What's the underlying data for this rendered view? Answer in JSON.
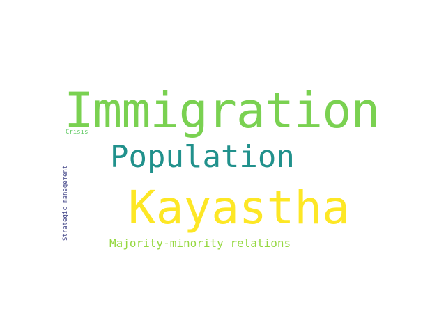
{
  "words": [
    {
      "text": "Immigration",
      "color": "#7ad151"
    },
    {
      "text": "Population",
      "color": "#21918c"
    },
    {
      "text": "Kayastha",
      "color": "#fde725"
    },
    {
      "text": "Majority-minority relations",
      "color": "#95d840"
    },
    {
      "text": "Crisis",
      "color": "#5ec962"
    },
    {
      "text": "Strategic management",
      "color": "#414487"
    }
  ]
}
